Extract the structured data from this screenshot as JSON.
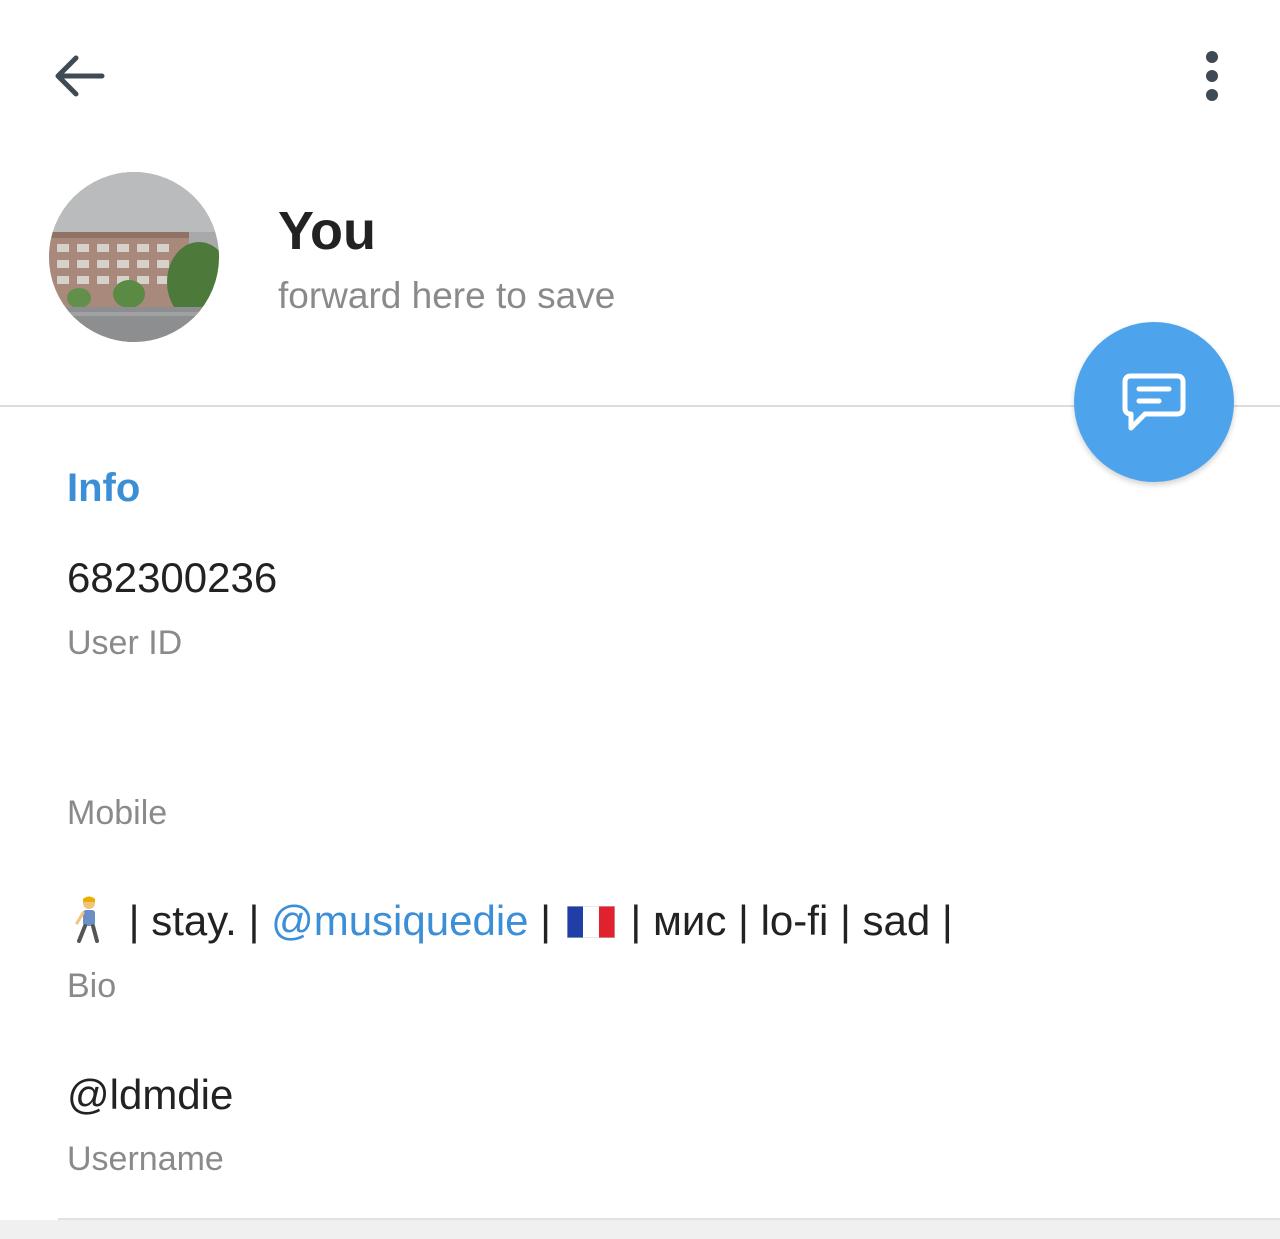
{
  "toolbar": {
    "back_icon": "arrow-left-icon",
    "menu_icon": "more-vertical-icon"
  },
  "profile": {
    "name": "You",
    "status": "forward here to save",
    "avatar_icon": "profile-photo-building"
  },
  "fab": {
    "icon": "message-icon",
    "color": "#4ea4ec"
  },
  "info": {
    "section_title": "Info",
    "user_id": {
      "value": "682300236",
      "label": "User ID"
    },
    "mobile": {
      "label": "Mobile"
    },
    "bio": {
      "emoji_icon": "person-walking-icon",
      "part1": " | stay. | ",
      "mention": "@musiquedie",
      "part2": " | ",
      "flag_icon": "france-flag-icon",
      "part3": " | мис | lo-fi | sad |",
      "label": "Bio"
    },
    "username": {
      "value": "@ldmdie",
      "label": "Username"
    }
  },
  "colors": {
    "accent": "#3c8fd6",
    "fab": "#4ea4ec",
    "secondary_text": "#8a8a8a",
    "divider": "#dcdcdc"
  }
}
